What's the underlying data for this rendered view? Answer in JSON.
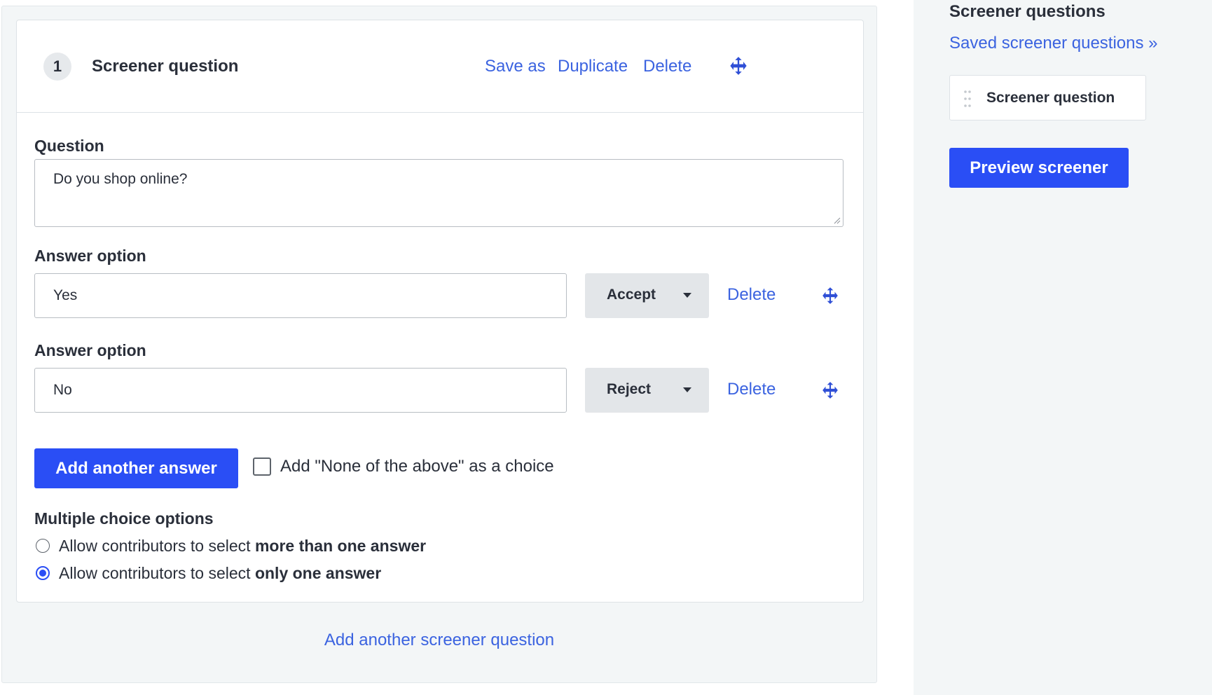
{
  "question_card": {
    "number": "1",
    "title": "Screener question",
    "actions": {
      "save_as": "Save as",
      "duplicate": "Duplicate",
      "delete": "Delete"
    },
    "question_label": "Question",
    "question_value": "Do you shop online?",
    "answers": [
      {
        "label": "Answer option",
        "value": "Yes",
        "selection": "Accept",
        "delete": "Delete"
      },
      {
        "label": "Answer option",
        "value": "No",
        "selection": "Reject",
        "delete": "Delete"
      }
    ],
    "add_answer_button": "Add another answer",
    "none_of_above": {
      "label": "Add \"None of the above\" as a choice",
      "checked": false
    },
    "multiple_choice": {
      "heading": "Multiple choice options",
      "options": [
        {
          "prefix": "Allow contributors to select ",
          "emphasis": "more than one answer",
          "selected": false
        },
        {
          "prefix": "Allow contributors to select ",
          "emphasis": "only one answer",
          "selected": true
        }
      ]
    }
  },
  "add_screener_question_link": "Add another screener question",
  "sidebar": {
    "title": "Screener questions",
    "saved_link": "Saved screener questions »",
    "items": [
      {
        "label": "Screener question"
      }
    ],
    "preview_button": "Preview screener"
  },
  "colors": {
    "accent": "#2a4ef5",
    "link": "#3b63e0",
    "panel_bg": "#f3f6f7",
    "text": "#2a2f3a"
  },
  "icons": {
    "move": "move-arrows-icon",
    "drag": "drag-handle-icon",
    "dropdown": "caret-down-icon"
  }
}
